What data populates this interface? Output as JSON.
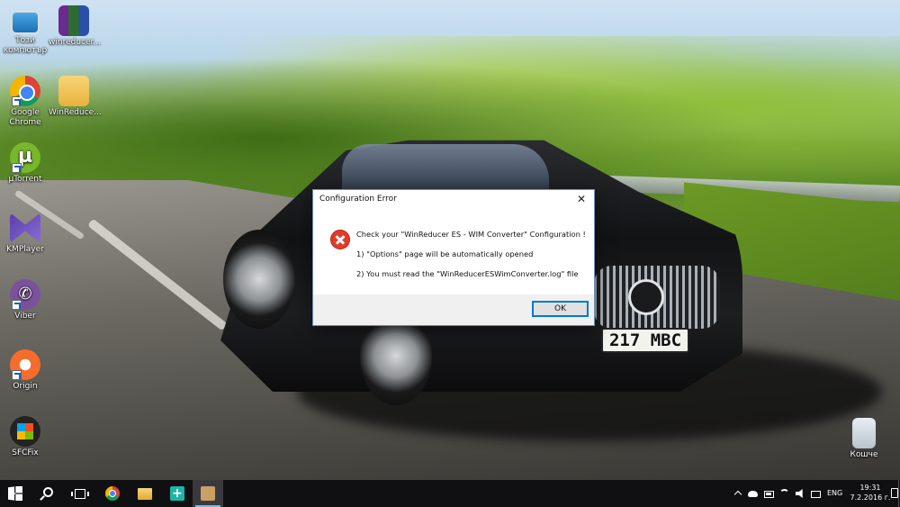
{
  "desktop": {
    "icons": [
      {
        "label": "Този компютър",
        "icon": "computer-icon"
      },
      {
        "label": "winreducer...",
        "icon": "winrar-archive-icon"
      },
      {
        "label": "Google Chrome",
        "icon": "chrome-icon"
      },
      {
        "label": "WinReduce...",
        "icon": "folder-icon"
      },
      {
        "label": "µTorrent",
        "icon": "utorrent-icon"
      },
      {
        "label": "KMPlayer",
        "icon": "kmplayer-icon"
      },
      {
        "label": "Viber",
        "icon": "viber-icon"
      },
      {
        "label": "Origin",
        "icon": "origin-icon"
      },
      {
        "label": "SFCFix",
        "icon": "sfcfix-icon"
      },
      {
        "label": "Кошче",
        "icon": "recycle-bin-icon"
      }
    ],
    "wallpaper": {
      "plate_text": "217 MBC"
    }
  },
  "dialog": {
    "title": "Configuration Error",
    "close_glyph": "✕",
    "icon": "error-icon",
    "lines": [
      "Check your \"WinReducer ES - WIM Converter\" Configuration !",
      "1) \"Options\" page will be automatically opened",
      "2) You must read the \"WinReducerESWimConverter.log\" file"
    ],
    "ok_label": "OK",
    "accent": "#0078d7"
  },
  "taskbar": {
    "pinned": [
      "start-icon",
      "search-icon",
      "task-view-icon",
      "chrome-icon",
      "file-explorer-icon",
      "plus-app-icon",
      "winreducer-icon"
    ],
    "tray": {
      "language": "ENG",
      "time": "19:31",
      "date": "7.2.2016 г."
    },
    "background": "#101013"
  }
}
